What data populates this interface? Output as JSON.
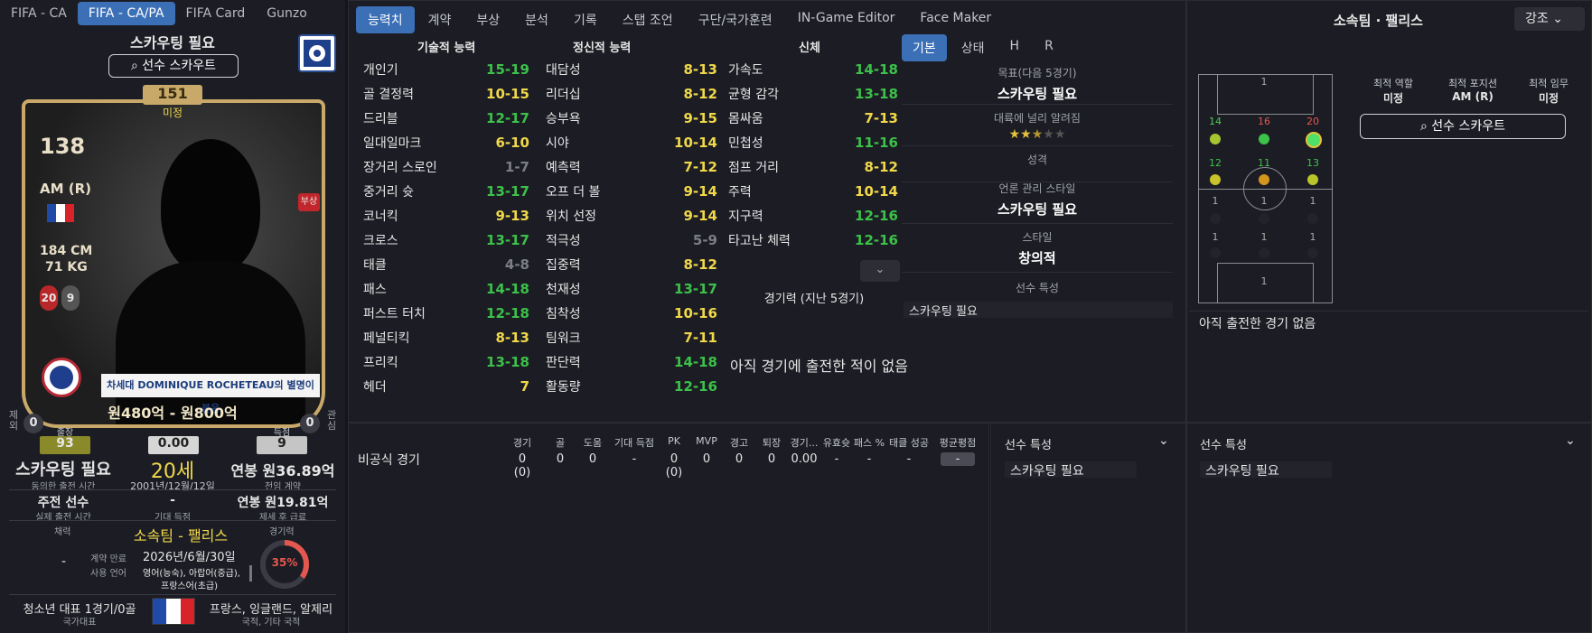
{
  "top_tabs": [
    "FIFA - CA",
    "FIFA - CA/PA",
    "FIFA Card",
    "Gunzo"
  ],
  "top_tabs_active": 1,
  "card": {
    "title": "스카우팅 필요",
    "scout_button": "선수 스카우트",
    "rating_top": "151",
    "rating_top_label": "미정",
    "ca": "138",
    "position": "AM (R)",
    "height": "184 CM",
    "weight": "71 KG",
    "num_left": "20",
    "num_right": "9",
    "injury_badge": "부상",
    "nickname": "차세대 DOMINIQUE ROCHETEAU의 별명이 붙음",
    "value": "원480억 - 원800억",
    "left_side_label": "제외",
    "left_count": "0",
    "right_side_label": "관심",
    "right_count": "0"
  },
  "left_stats": {
    "apps_label": "출장",
    "apps": "93",
    "avg": "0.00",
    "goals_label": "득점",
    "goals": "9",
    "contract_status": "스카우팅 필요",
    "contract_sub": "동의한 출전 시간",
    "age": "20세",
    "dob": "2001년/12월/12일",
    "wage": "연봉 원36.89억",
    "wage_sub": "전임 계약",
    "role": "주전 선수",
    "role_sub": "실제 출전 시간",
    "expected": "-",
    "expected_sub": "기대 득점",
    "wage2": "연봉 원19.81억",
    "wage2_sub": "제세 후 급료",
    "loan_label": "채력",
    "club": "소속팀 - 팰리스",
    "form_label": "경기력",
    "dash": "-",
    "contract_end_label": "계약 만료",
    "contract_end": "2026년/6월/30일",
    "lang_label": "사용 언어",
    "lang1": "영어(능숙), 아랍어(중급),",
    "lang2": "프랑스어(초급)",
    "form_pct": "35%",
    "youth": "청소년 대표 1경기/0골",
    "youth_sub": "국가대표",
    "nationality": "프랑스, 잉글랜드, 알제리",
    "nationality_sub": "국적, 기타 국적"
  },
  "main_tabs": [
    "능력치",
    "계약",
    "부상",
    "분석",
    "기록",
    "스탭 조언",
    "구단/국가훈련",
    "IN-Game Editor",
    "Face Maker"
  ],
  "main_tabs_active": 0,
  "col_headers": {
    "technical": "기술적 능력",
    "mental": "정신적 능력",
    "physical": "신체"
  },
  "technical": [
    {
      "name": "개인기",
      "val": "15-19",
      "c": "green"
    },
    {
      "name": "골 결정력",
      "val": "10-15",
      "c": "yellow"
    },
    {
      "name": "드리블",
      "val": "12-17",
      "c": "green"
    },
    {
      "name": "일대일마크",
      "val": "6-10",
      "c": "yellow"
    },
    {
      "name": "장거리 스로인",
      "val": "1-7",
      "c": "grey"
    },
    {
      "name": "중거리 슛",
      "val": "13-17",
      "c": "green"
    },
    {
      "name": "코너킥",
      "val": "9-13",
      "c": "yellow"
    },
    {
      "name": "크로스",
      "val": "13-17",
      "c": "green"
    },
    {
      "name": "태클",
      "val": "4-8",
      "c": "grey"
    },
    {
      "name": "패스",
      "val": "14-18",
      "c": "green"
    },
    {
      "name": "퍼스트 터치",
      "val": "12-18",
      "c": "green"
    },
    {
      "name": "페널티킥",
      "val": "8-13",
      "c": "yellow"
    },
    {
      "name": "프리킥",
      "val": "13-18",
      "c": "green"
    },
    {
      "name": "헤더",
      "val": "7",
      "c": "yellow"
    }
  ],
  "mental": [
    {
      "name": "대담성",
      "val": "8-13",
      "c": "yellow"
    },
    {
      "name": "리더십",
      "val": "8-12",
      "c": "yellow"
    },
    {
      "name": "승부욕",
      "val": "9-15",
      "c": "yellow"
    },
    {
      "name": "시야",
      "val": "10-14",
      "c": "yellow"
    },
    {
      "name": "예측력",
      "val": "7-12",
      "c": "yellow"
    },
    {
      "name": "오프 더 볼",
      "val": "9-14",
      "c": "yellow"
    },
    {
      "name": "위치 선정",
      "val": "9-14",
      "c": "yellow"
    },
    {
      "name": "적극성",
      "val": "5-9",
      "c": "grey"
    },
    {
      "name": "집중력",
      "val": "8-12",
      "c": "yellow"
    },
    {
      "name": "천재성",
      "val": "13-17",
      "c": "green"
    },
    {
      "name": "침착성",
      "val": "10-16",
      "c": "yellow"
    },
    {
      "name": "팀워크",
      "val": "7-11",
      "c": "yellow"
    },
    {
      "name": "판단력",
      "val": "14-18",
      "c": "green"
    },
    {
      "name": "활동량",
      "val": "12-16",
      "c": "green"
    }
  ],
  "physical": [
    {
      "name": "가속도",
      "val": "14-18",
      "c": "green"
    },
    {
      "name": "균형 감각",
      "val": "13-18",
      "c": "green"
    },
    {
      "name": "몸싸움",
      "val": "7-13",
      "c": "yellow"
    },
    {
      "name": "민첩성",
      "val": "11-16",
      "c": "green"
    },
    {
      "name": "점프 거리",
      "val": "8-12",
      "c": "yellow"
    },
    {
      "name": "주력",
      "val": "10-14",
      "c": "yellow"
    },
    {
      "name": "지구력",
      "val": "12-16",
      "c": "green"
    },
    {
      "name": "타고난 체력",
      "val": "12-16",
      "c": "green"
    }
  ],
  "form_title": "경기력 (지난 5경기)",
  "no_games": "아직 경기에 출전한 적이 없음",
  "side_tabs": [
    "기본",
    "상태",
    "H",
    "R"
  ],
  "side_info": {
    "target_label": "목표(다음 5경기)",
    "target": "스카우팅 필요",
    "fame_label": "대륙에 널리 알려짐",
    "stars": 2.5,
    "personality_label": "성격",
    "media_label": "언론 관리 스타일",
    "media": "스카우팅 필요",
    "style_label": "스타일",
    "style": "창의적",
    "traits_label": "선수 특성",
    "traits": "스카우팅 필요"
  },
  "right": {
    "title": "소속팀 · 팰리스",
    "highlight": "강조",
    "best_role_label": "최적 역할",
    "best_role": "미정",
    "best_pos_label": "최적 포지션",
    "best_pos": "AM (R)",
    "best_duty_label": "최적 임무",
    "best_duty": "미정",
    "scout_button": "선수 스카우트",
    "no_games": "아직 출전한 경기 없음",
    "pitch_numbers": {
      "gk_top": "1",
      "amr_row": [
        "14",
        "16",
        "20"
      ],
      "mid_row": [
        "12",
        "11",
        "13"
      ],
      "row3": [
        "1",
        "1",
        "1"
      ],
      "row4": [
        "1",
        "1",
        "1"
      ],
      "gk_bottom": "1"
    }
  },
  "stats_table": {
    "headers": [
      "경기",
      "골",
      "도움",
      "기대 득점",
      "PK",
      "MVP",
      "경고",
      "퇴장",
      "경기...",
      "유효슛",
      "패스 %",
      "태클 성공",
      "평균평점"
    ],
    "row_label": "비공식 경기",
    "values": [
      "0 (0)",
      "0",
      "0",
      "-",
      "0 (0)",
      "0",
      "0",
      "0",
      "0.00",
      "-",
      "-",
      "-",
      "-"
    ]
  },
  "bottom_traits": [
    {
      "title": "선수 특성",
      "value": "스카우팅 필요"
    },
    {
      "title": "선수 특성",
      "value": "스카우팅 필요"
    }
  ]
}
